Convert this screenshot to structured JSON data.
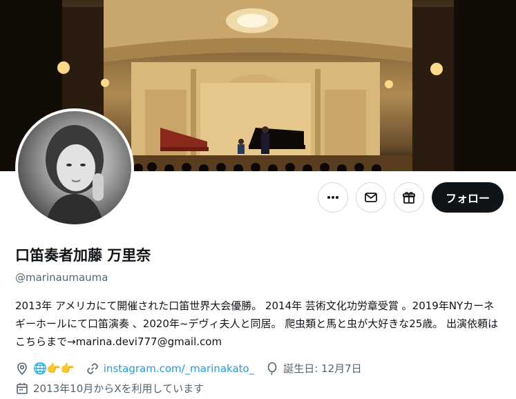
{
  "banner": {
    "alt": "Concert hall with piano and harpsichord"
  },
  "profile": {
    "name": "口笛奏者加藤 万里奈",
    "handle": "@marinaumauma",
    "bio": "2013年 アメリカにて開催された口笛世界大会優勝。 2014年 芸術文化功労章受賞 。2019年NYカーネギーホールにて口笛演奏 、2020年~デヴィ夫人と同居。 爬虫類と馬と虫が大好きな25歳。 出演依頼はこちらまで→marina.devi777@gmail.com",
    "location_emojis": "🌐👉👉",
    "website": "instagram.com/_marinakato_",
    "birthday": "誕生日: 12月7日",
    "joined": "2013年10月からXを利用しています"
  },
  "actions": {
    "more_icon": "more-icon",
    "message_icon": "mail-icon",
    "gift_icon": "gift-icon",
    "follow_label": "フォロー"
  },
  "colors": {
    "accent": "#1d9bf0",
    "text": "#0f1419",
    "secondary": "#536471",
    "follow_bg": "#0f1419"
  }
}
